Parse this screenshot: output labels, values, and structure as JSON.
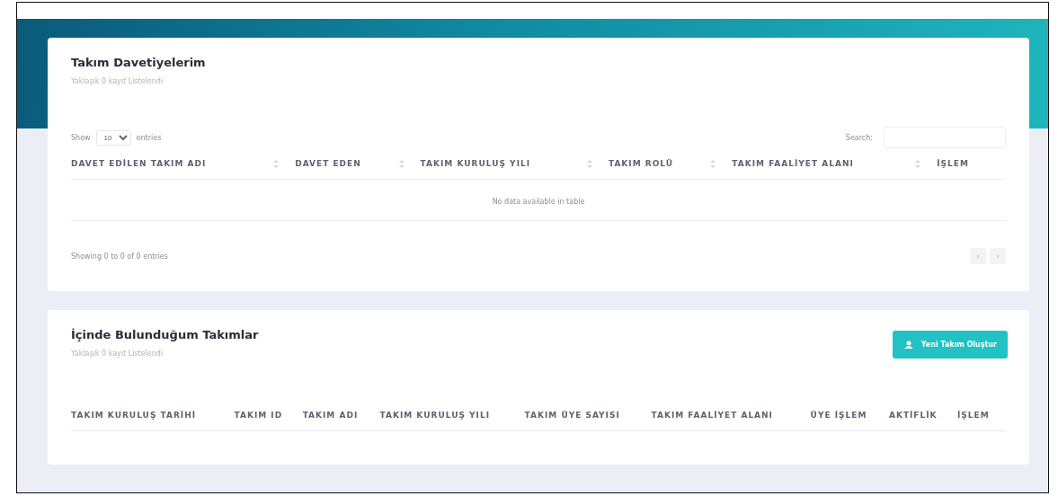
{
  "invitations": {
    "title": "Takım Davetiyelerim",
    "subtitle": "Yaklaşık 0 kayıt Listelendi",
    "length": {
      "prefix": "Show",
      "value": "10",
      "suffix": "entries"
    },
    "search": {
      "label": "Search:"
    },
    "columns": [
      {
        "label": "DAVET EDİLEN TAKIM ADI",
        "sortable": true
      },
      {
        "label": "DAVET EDEN",
        "sortable": true
      },
      {
        "label": "TAKIM KURULUŞ YILI",
        "sortable": true
      },
      {
        "label": "TAKIM ROLÜ",
        "sortable": true
      },
      {
        "label": "TAKIM FAALİYET ALANI",
        "sortable": true
      },
      {
        "label": "İŞLEM",
        "sortable": false
      }
    ],
    "empty": "No data available in table",
    "info": "Showing 0 to 0 of 0 entries",
    "pagination": [
      "‹",
      "›"
    ]
  },
  "teams": {
    "title": "İçinde Bulunduğum Takımlar",
    "subtitle": "Yaklaşık 0 kayıt Listelendi",
    "button": "Yeni Takım Oluştur",
    "columns": [
      "TAKIM KURULUŞ TARİHİ",
      "TAKIM ID",
      "TAKIM ADI",
      "TAKIM KURULUŞ YILI",
      "TAKIM ÜYE SAYISI",
      "TAKIM FAALİYET ALANI",
      "ÜYE İŞLEM",
      "AKTİFLİK",
      "İŞLEM"
    ]
  }
}
